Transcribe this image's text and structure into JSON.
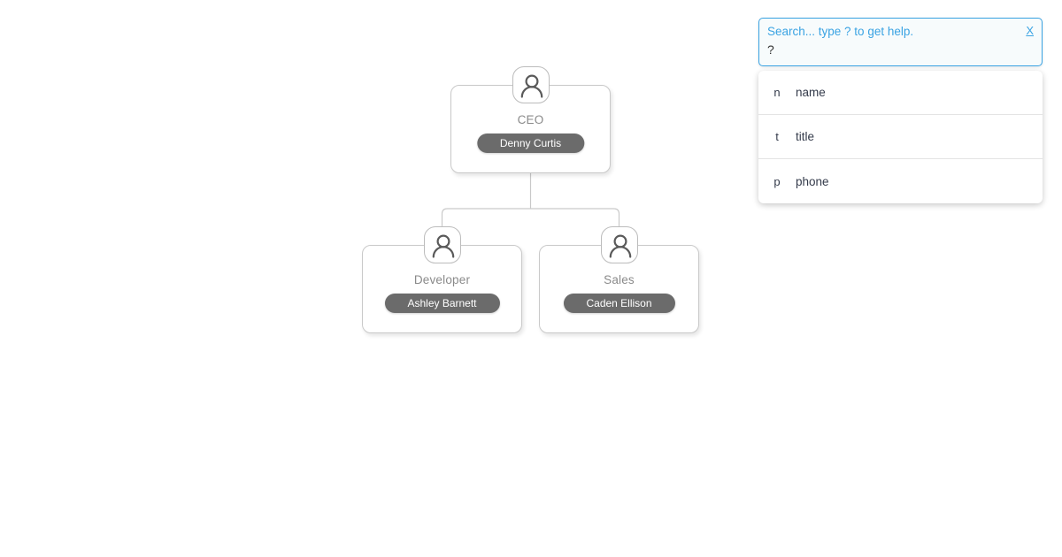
{
  "orgchart": {
    "nodes": [
      {
        "id": "ceo",
        "title": "CEO",
        "name": "Denny Curtis",
        "avatar_icon": "person-avatar-icon"
      },
      {
        "id": "developer",
        "title": "Developer",
        "name": "Ashley Barnett",
        "avatar_icon": "person-avatar-icon"
      },
      {
        "id": "sales",
        "title": "Sales",
        "name": "Caden Ellison",
        "avatar_icon": "person-avatar-icon"
      }
    ],
    "edges": [
      {
        "from": "ceo",
        "to": "developer"
      },
      {
        "from": "ceo",
        "to": "sales"
      }
    ],
    "colors": {
      "node_border": "#c9c9c9",
      "node_background": "#ffffff",
      "title_text": "#8a8a8a",
      "pill_background": "#6b6b6b",
      "pill_text": "#ffffff",
      "connector": "#c9c9c9"
    }
  },
  "search": {
    "hint": "Search... type ? to get help.",
    "close_label": "X",
    "close_icon": "close-x-icon",
    "value": "?",
    "placeholder": "Search... type ? to get help.",
    "accent_color": "#3aa3e3",
    "results": [
      {
        "key": "n",
        "label": "name"
      },
      {
        "key": "t",
        "label": "title"
      },
      {
        "key": "p",
        "label": "phone"
      }
    ]
  }
}
